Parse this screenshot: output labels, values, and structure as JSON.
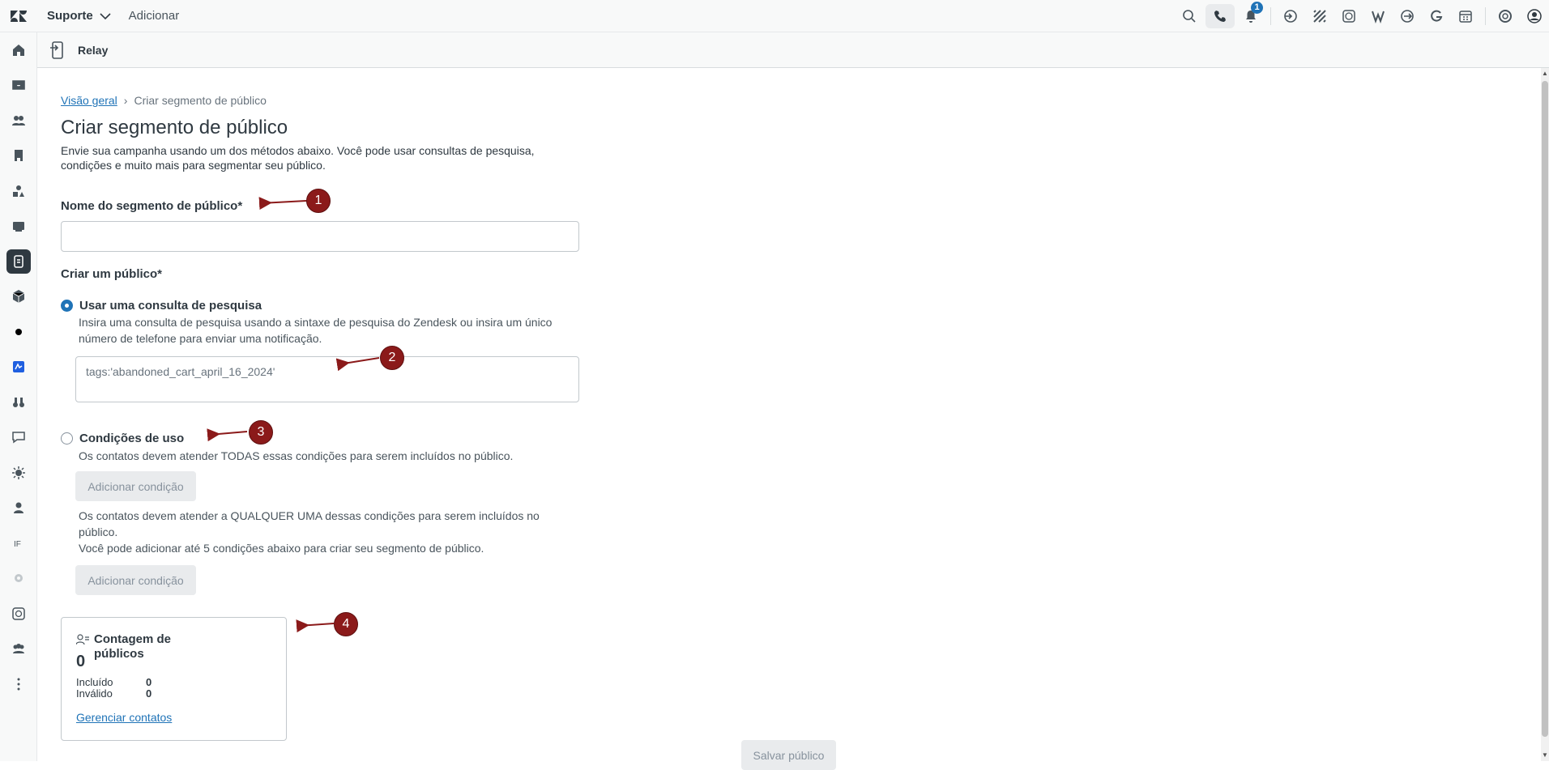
{
  "topbar": {
    "product_label": "Suporte",
    "add_label": "Adicionar",
    "notification_count": "1"
  },
  "app": {
    "title": "Relay"
  },
  "breadcrumb": {
    "link": "Visão geral",
    "current": "Criar segmento de público"
  },
  "page": {
    "title": "Criar segmento de público",
    "intro": "Envie sua campanha usando um dos métodos abaixo. Você pode usar consultas de pesquisa, condições e muito mais para segmentar seu público."
  },
  "form": {
    "name_label": "Nome do segmento de público*",
    "name_value": "",
    "create_label": "Criar um público*",
    "option_search": {
      "label": "Usar uma consulta de pesquisa",
      "help": "Insira uma consulta de pesquisa usando a sintaxe de pesquisa do Zendesk ou insira um único número de telefone para enviar uma notificação.",
      "placeholder": "tags:'abandoned_cart_april_16_2024'"
    },
    "option_conditions": {
      "label": "Condições de uso",
      "help_all": "Os contatos devem atender TODAS essas condições para serem incluídos no público.",
      "add_condition_1": "Adicionar condição",
      "help_any": "Os contatos devem atender a QUALQUER UMA dessas condições para serem incluídos no público.",
      "help_limit": "Você pode adicionar até 5 condições abaixo para criar seu segmento de público.",
      "add_condition_2": "Adicionar condição"
    }
  },
  "count_card": {
    "title": "Contagem de públicos",
    "total": "0",
    "included_label": "Incluído",
    "included_value": "0",
    "invalid_label": "Inválido",
    "invalid_value": "0",
    "manage_link": "Gerenciar contatos"
  },
  "save_label": "Salvar público",
  "callouts": [
    "1",
    "2",
    "3",
    "4"
  ],
  "colors": {
    "accent": "#1f73b7",
    "callout": "#8b1a1a",
    "text": "#2f3941"
  }
}
